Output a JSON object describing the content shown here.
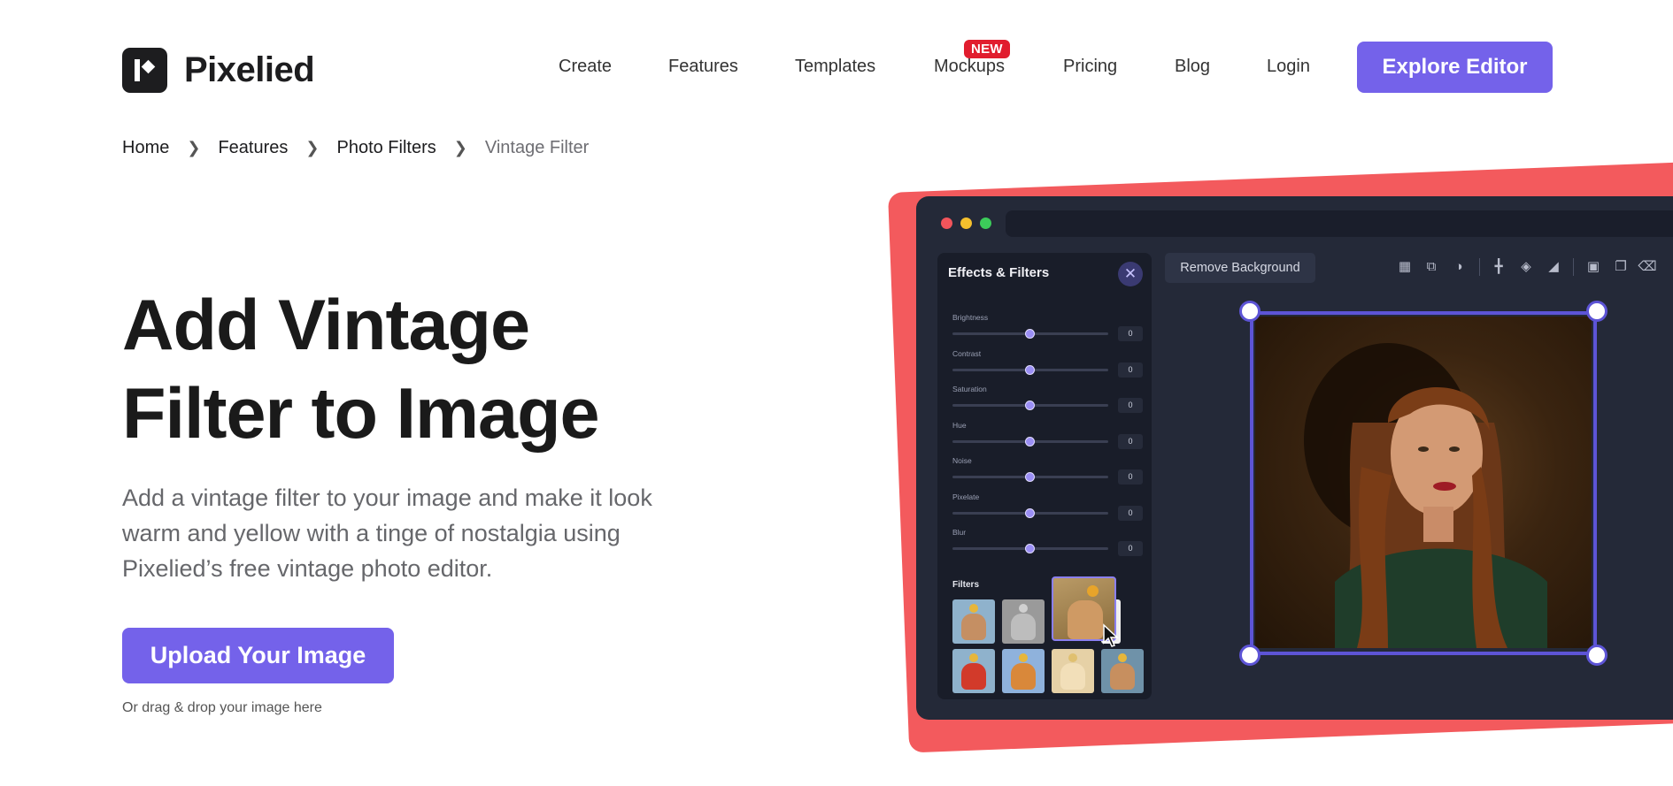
{
  "header": {
    "logo_text": "Pixelied",
    "nav": [
      "Create",
      "Features",
      "Templates",
      "Mockups",
      "Pricing",
      "Blog",
      "Login"
    ],
    "badge": "NEW",
    "cta": "Explore Editor"
  },
  "breadcrumb": {
    "items": [
      "Home",
      "Features",
      "Photo Filters"
    ],
    "current": "Vintage Filter"
  },
  "hero": {
    "title": "Add Vintage Filter to Image",
    "subtitle": "Add a vintage filter to your image and make it look warm and yellow with a tinge of nostalgia using Pixelied’s free vintage photo editor.",
    "upload_button": "Upload Your Image",
    "drag_hint": "Or drag & drop your image here"
  },
  "editor": {
    "panel_title": "Effects & Filters",
    "sliders": [
      {
        "label": "Brightness",
        "value": "0"
      },
      {
        "label": "Contrast",
        "value": "0"
      },
      {
        "label": "Saturation",
        "value": "0"
      },
      {
        "label": "Hue",
        "value": "0"
      },
      {
        "label": "Noise",
        "value": "0"
      },
      {
        "label": "Pixelate",
        "value": "0"
      },
      {
        "label": "Blur",
        "value": "0"
      }
    ],
    "filters_label": "Filters",
    "remove_bg": "Remove Background",
    "colors": {
      "accent": "#7462ea",
      "selection": "#5d54d6",
      "backdrop": "#f35a5d",
      "window": "#242938"
    }
  }
}
